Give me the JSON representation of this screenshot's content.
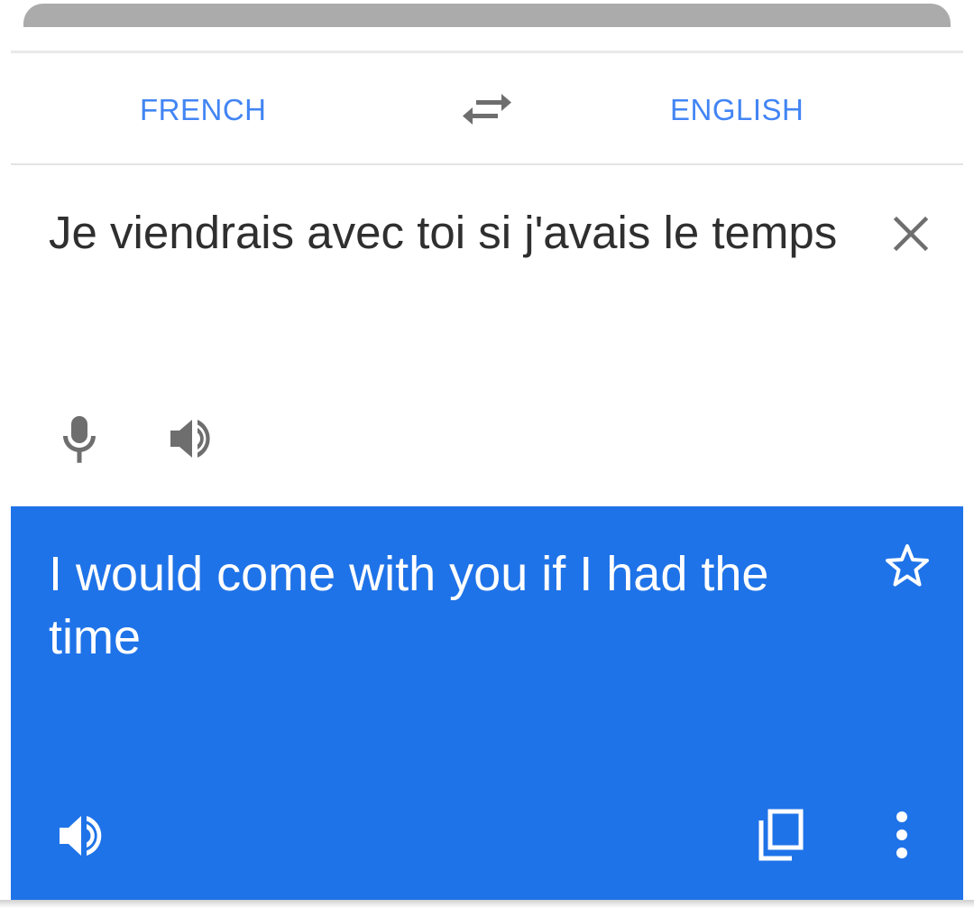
{
  "languages": {
    "source": "FRENCH",
    "target": "ENGLISH"
  },
  "input": {
    "text": "Je viendrais avec toi si j'avais le temps"
  },
  "result": {
    "text": "I would come with you if I had the time"
  },
  "icons": {
    "swap": "swap-arrows-icon",
    "clear": "close-icon",
    "mic": "microphone-icon",
    "speak_source": "speaker-icon",
    "star": "star-outline-icon",
    "speak_result": "speaker-icon",
    "copy": "copy-icon",
    "more": "more-vert-icon"
  },
  "colors": {
    "accent_text": "#4285f4",
    "result_bg": "#1f73e8",
    "icon_gray": "#6e6e6e",
    "icon_white": "#ffffff"
  }
}
